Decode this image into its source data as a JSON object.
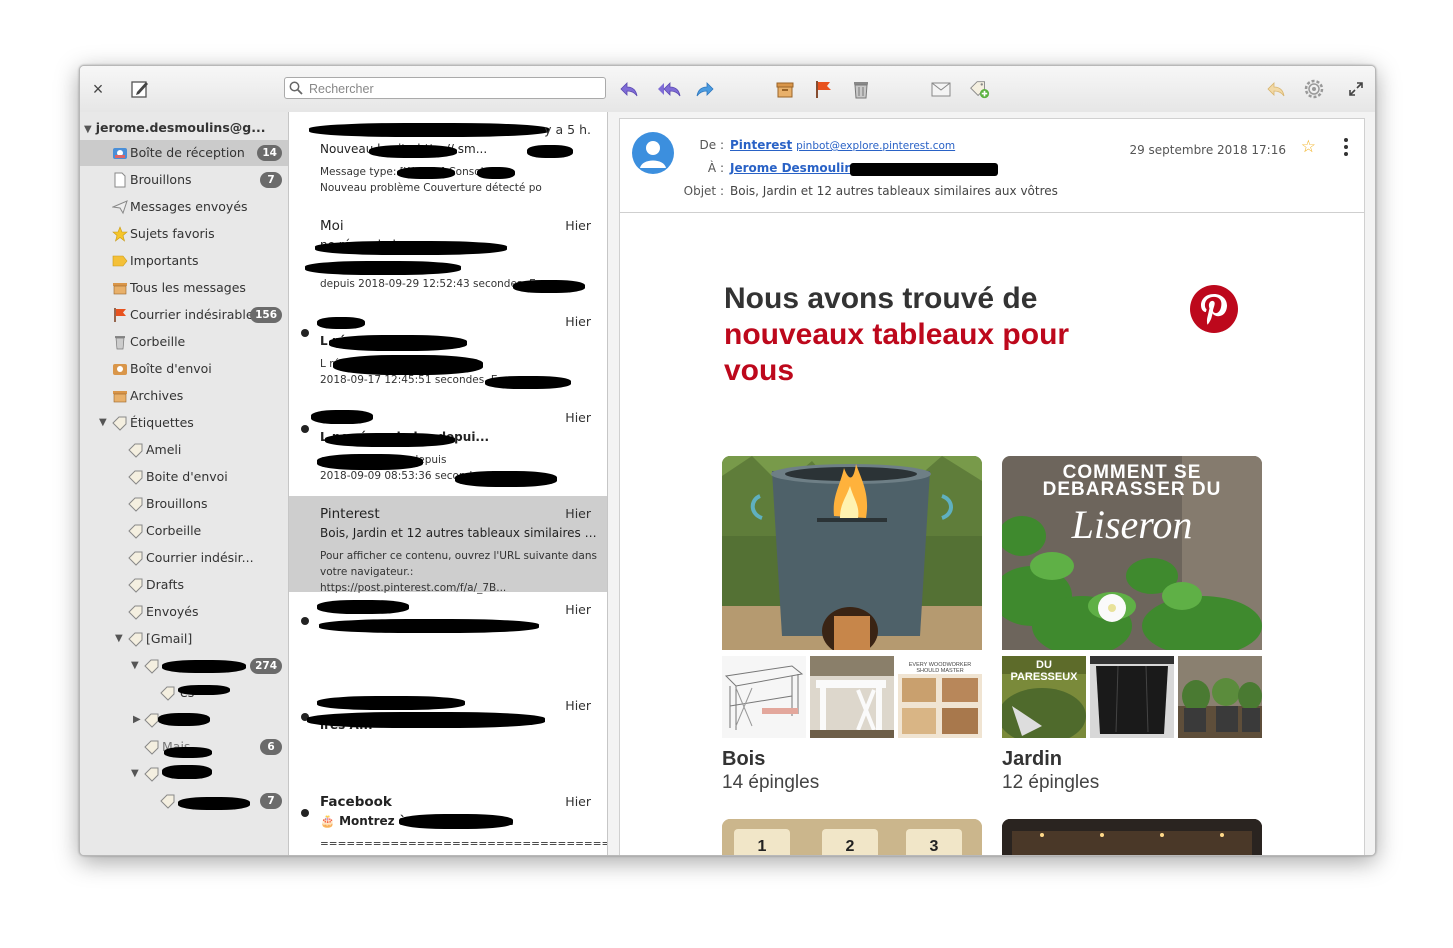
{
  "toolbar": {
    "search_placeholder": "Rechercher",
    "close_label": "×"
  },
  "sidebar": {
    "account": "jerome.desmoulins@g...",
    "folders": [
      {
        "label": "Boîte de réception",
        "badge": "14"
      },
      {
        "label": "Brouillons",
        "badge": "7"
      },
      {
        "label": "Messages envoyés",
        "badge": ""
      },
      {
        "label": "Sujets favoris",
        "badge": ""
      },
      {
        "label": "Importants",
        "badge": ""
      },
      {
        "label": "Tous les messages",
        "badge": ""
      },
      {
        "label": "Courrier indésirable",
        "badge": "156"
      },
      {
        "label": "Corbeille",
        "badge": ""
      },
      {
        "label": "Boîte d'envoi",
        "badge": ""
      },
      {
        "label": "Archives",
        "badge": ""
      }
    ],
    "labels_title": "Étiquettes",
    "labels": [
      "Ameli",
      "Boite d'envoi",
      "Brouillons",
      "Corbeille",
      "Courrier indésir...",
      "Drafts",
      "Envoyés"
    ],
    "gmail": "[Gmail]",
    "gmail_badges": [
      "274",
      "6",
      "7"
    ],
    "gmail_fragments": [
      "es",
      "Mais"
    ]
  },
  "messages": [
    {
      "from": "",
      "time": "y a 5 h.",
      "subject": "Nouveau                   le site http://               sm...",
      "preview1": "Message type: [W                032              ] Console",
      "preview2": "Nouveau problème Couverture détecté po"
    },
    {
      "from": "Moi",
      "time": "Hier",
      "subject": "                                               ne répond plus ...",
      "preview1": "                                        nna ne répond plus",
      "preview2": "depuis 2018-09-29 12:52:43 secondes. E"
    },
    {
      "from": "",
      "time": "Hier",
      "subject": "L                                     répond plus de...",
      "preview1": "L                                          répond plus depuis",
      "preview2": "2018-09-17 12:45:51 secondes. E"
    },
    {
      "from": "",
      "time": "Hier",
      "subject": "L                                     ne répond plus depui...",
      "preview1": "                                  e ne répond plus depuis",
      "preview2": "2018-09-09 08:53:36 secondes. P"
    },
    {
      "from": "Pinterest",
      "time": "Hier",
      "subject": "Bois, Jardin et 12 autres tableaux similaires aux ...",
      "preview1": "Pour afficher ce contenu, ouvrez l'URL suivante dans",
      "preview2": "votre navigateur.: https://post.pinterest.com/f/a/_7B..."
    },
    {
      "from": "",
      "time": "Hier",
      "subject": "",
      "preview1": "",
      "preview2": ""
    },
    {
      "from": "",
      "time": "Hier",
      "subject": "                                                    ires A...",
      "preview1": "",
      "preview2": ""
    },
    {
      "from": "Facebook",
      "time": "Hier",
      "subject": "🎂 Montrez à                            ue vous pens...",
      "preview1": "========================================= Acc",
      "preview2": ""
    }
  ],
  "email": {
    "from_label": "De :",
    "from_name": "Pinterest",
    "from_email": "pinbot@explore.pinterest.com",
    "to_label": "À :",
    "to_name": "Jerome Desmoulins",
    "subject_label": "Objet :",
    "subject": "Bois, Jardin et 12 autres tableaux similaires aux vôtres",
    "date": "29 septembre 2018 17:16",
    "headline_line1": "Nous avons trouvé de",
    "headline_red": "nouveaux tableaux pour vous",
    "boards": [
      {
        "title": "Bois",
        "count": "14 épingles"
      },
      {
        "title": "Jardin",
        "count": "12 épingles"
      }
    ],
    "poster_text": "COMMENT SE DEBARASSER DU",
    "poster_script": "Liseron",
    "thumb_text": "DU PARESSEUX",
    "colors": {
      "pinterest_red": "#bd081c",
      "link_blue": "#2962c6"
    }
  }
}
